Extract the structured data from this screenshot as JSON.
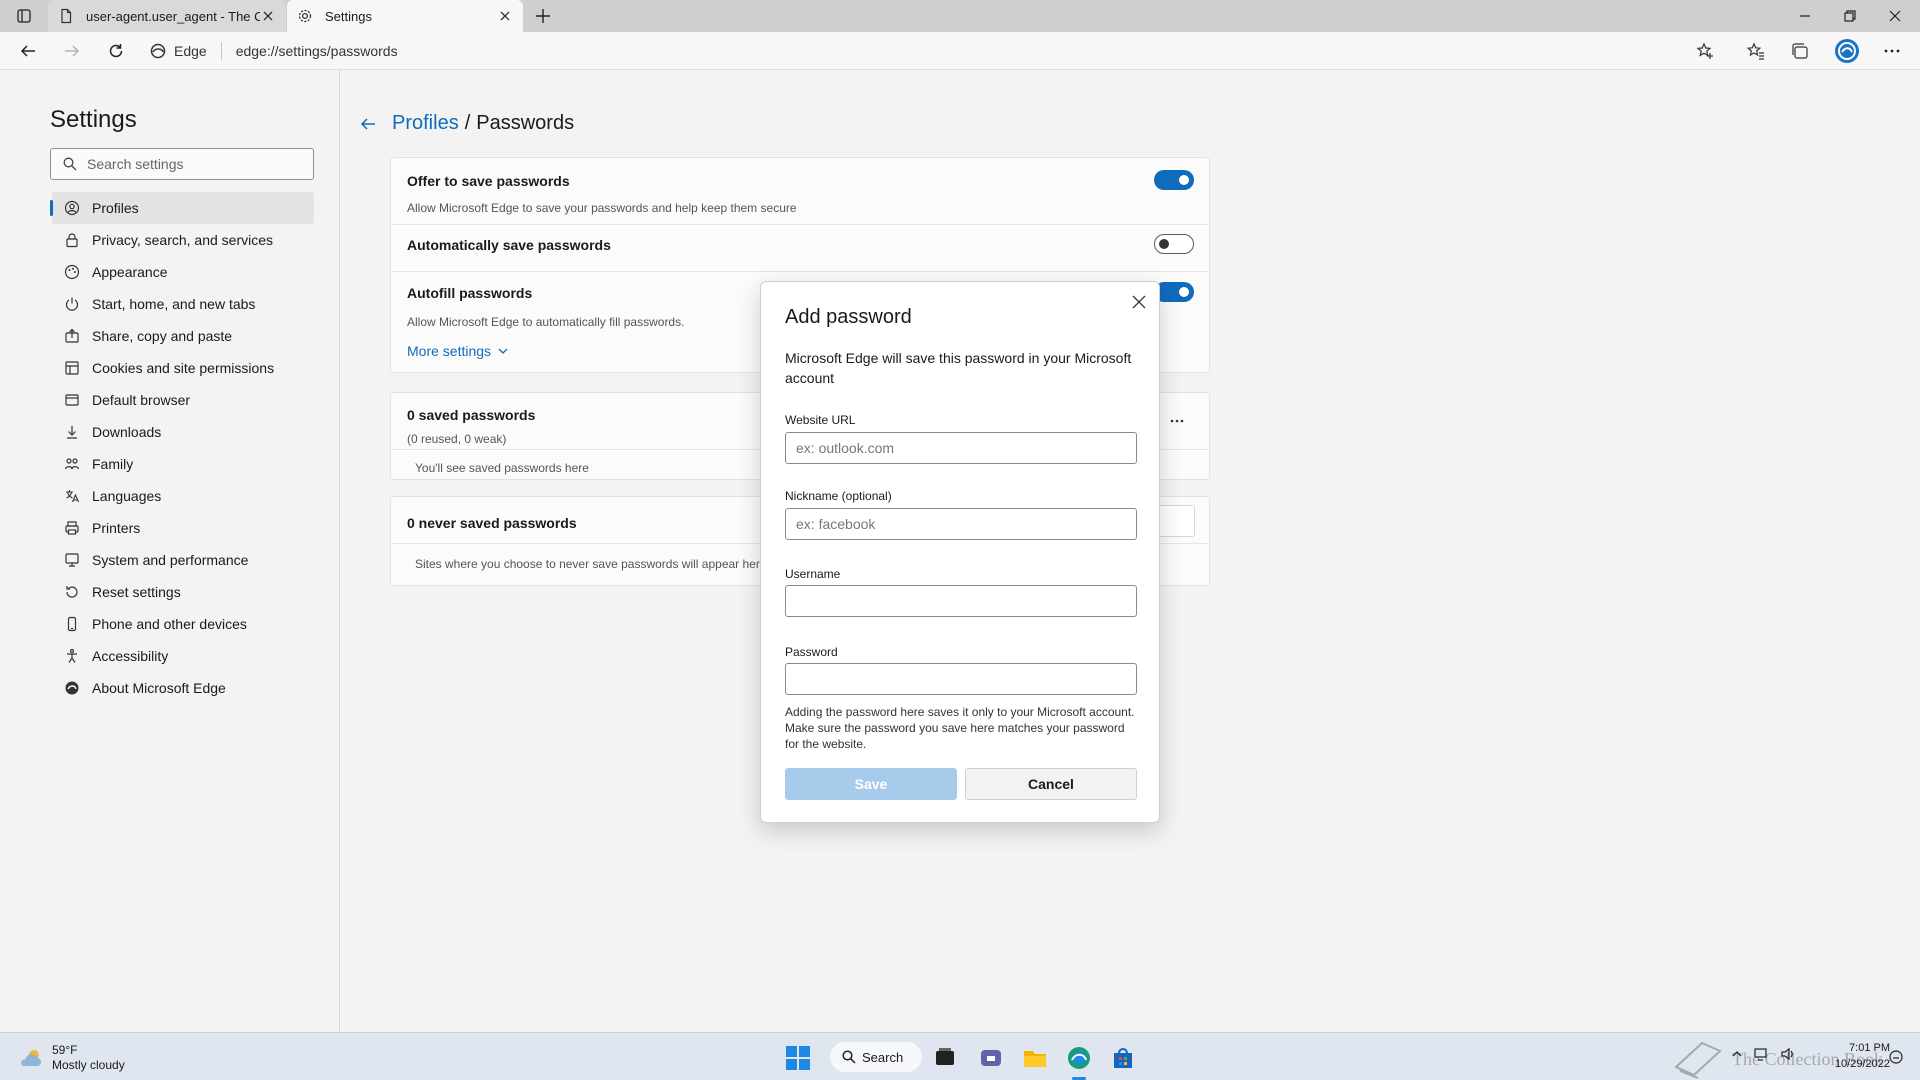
{
  "browser": {
    "tabs": [
      {
        "label": "user-agent.user_agent - The Coll",
        "icon": "page-icon",
        "active": false
      },
      {
        "label": "Settings",
        "icon": "gear-icon",
        "active": true
      }
    ],
    "site_chip": "Edge",
    "url": "edge://settings/passwords"
  },
  "sidebar": {
    "title": "Settings",
    "search_placeholder": "Search settings",
    "items": [
      {
        "label": "Profiles",
        "icon": "profile-icon",
        "active": true
      },
      {
        "label": "Privacy, search, and services",
        "icon": "lock-icon"
      },
      {
        "label": "Appearance",
        "icon": "appearance-icon"
      },
      {
        "label": "Start, home, and new tabs",
        "icon": "power-icon"
      },
      {
        "label": "Share, copy and paste",
        "icon": "share-icon"
      },
      {
        "label": "Cookies and site permissions",
        "icon": "cookie-icon"
      },
      {
        "label": "Default browser",
        "icon": "browser-icon"
      },
      {
        "label": "Downloads",
        "icon": "download-icon"
      },
      {
        "label": "Family",
        "icon": "family-icon"
      },
      {
        "label": "Languages",
        "icon": "language-icon"
      },
      {
        "label": "Printers",
        "icon": "printer-icon"
      },
      {
        "label": "System and performance",
        "icon": "system-icon"
      },
      {
        "label": "Reset settings",
        "icon": "reset-icon"
      },
      {
        "label": "Phone and other devices",
        "icon": "phone-icon"
      },
      {
        "label": "Accessibility",
        "icon": "accessibility-icon"
      },
      {
        "label": "About Microsoft Edge",
        "icon": "edge-logo-icon"
      }
    ]
  },
  "main": {
    "breadcrumb_parent": "Profiles",
    "breadcrumb_sep": "/",
    "breadcrumb_current": "Passwords",
    "offer_title": "Offer to save passwords",
    "offer_sub": "Allow Microsoft Edge to save your passwords and help keep them secure",
    "offer_on": true,
    "auto_title": "Automatically save passwords",
    "auto_on": false,
    "autofill_title": "Autofill passwords",
    "autofill_sub": "Allow Microsoft Edge to automatically fill passwords.",
    "autofill_on": true,
    "more_settings": "More settings",
    "saved_title": "0 saved passwords",
    "saved_sub": "(0 reused, 0 weak)",
    "saved_empty": "You'll see saved passwords here",
    "never_title": "0 never saved passwords",
    "never_empty": "Sites where you choose to never save passwords will appear here"
  },
  "dialog": {
    "title": "Add password",
    "description": "Microsoft Edge will save this password in your Microsoft account",
    "url_label": "Website URL",
    "url_placeholder": "ex: outlook.com",
    "nickname_label": "Nickname (optional)",
    "nickname_placeholder": "ex: facebook",
    "username_label": "Username",
    "username_value": "",
    "password_label": "Password",
    "password_value": "",
    "note": "Adding the password here saves it only to your Microsoft account. Make sure the password you save here matches your password for the website.",
    "save_label": "Save",
    "cancel_label": "Cancel"
  },
  "taskbar": {
    "temperature": "59°F",
    "condition": "Mostly cloudy",
    "search_label": "Search",
    "time": "7:01 PM",
    "date": "10/29/2022",
    "watermark": "The Collection Book"
  },
  "colors": {
    "accent": "#0f6cbd",
    "save_disabled": "#a7cbea",
    "taskbar": "#dfe6ef"
  }
}
